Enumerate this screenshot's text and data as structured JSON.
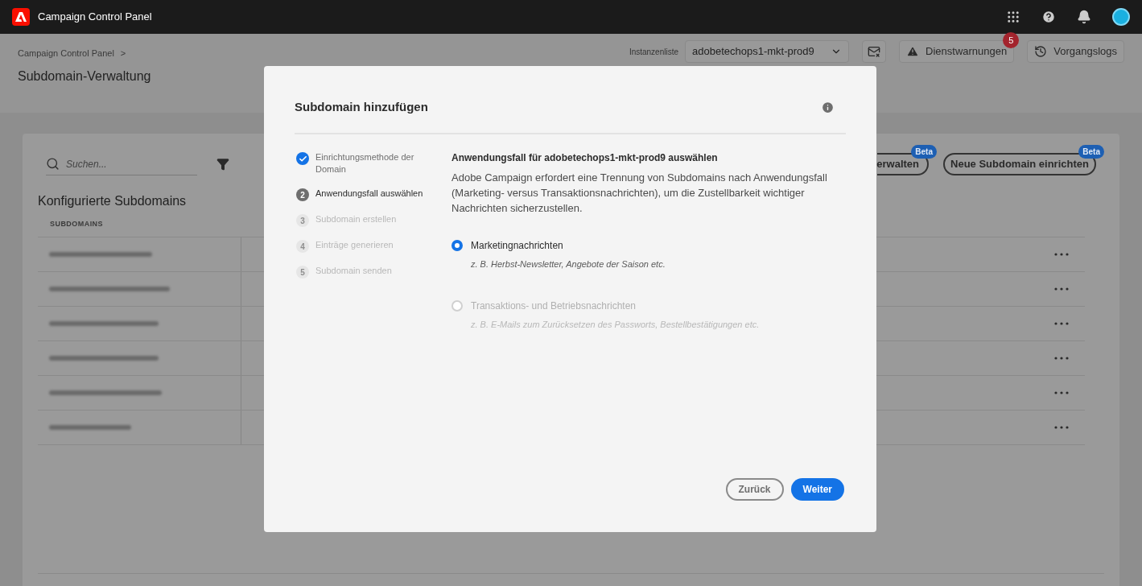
{
  "top_bar": {
    "title": "Campaign Control Panel"
  },
  "header": {
    "breadcrumb": "Campaign Control Panel",
    "breadcrumb_separator": ">",
    "title": "Subdomain-Verwaltung",
    "instance_label": "Instanzenliste",
    "instance_value": "adobetechops1-mkt-prod9",
    "buttons": [
      {
        "kind": "mail"
      },
      {
        "kind": "warning",
        "label": "Dienstwarnungen",
        "badge": "5"
      },
      {
        "kind": "history",
        "label": "Vorgangslogs"
      }
    ]
  },
  "card": {
    "search": {
      "placeholder": "Suchen..."
    },
    "actions": [
      {
        "label": "erwalten",
        "badge": "Beta"
      },
      {
        "label": "Neue Subdomain einrichten",
        "badge": "Beta"
      }
    ],
    "title": "Konfigurierte Subdomains",
    "column": "SUBDOMAINS",
    "rows": [
      {
        "kind": "blurred"
      },
      {
        "kind": "blurred"
      },
      {
        "kind": "blurred"
      },
      {
        "kind": "blurred"
      },
      {
        "kind": "blurred"
      },
      {
        "kind": "blurred"
      }
    ]
  },
  "dialog": {
    "title": "Subdomain hinzufügen",
    "steps": [
      {
        "label": "Einrichtungsmethode der Domain",
        "completed": true,
        "selected": false
      },
      {
        "number": "2",
        "label": "Anwendungsfall auswählen",
        "completed": false,
        "selected": true
      },
      {
        "number": "3",
        "label": "Subdomain erstellen",
        "completed": false,
        "selected": false
      },
      {
        "number": "4",
        "label": "Einträge generieren",
        "completed": false,
        "selected": false
      },
      {
        "number": "5",
        "label": "Subdomain senden",
        "completed": false,
        "selected": false
      }
    ],
    "heading": "Anwendungsfall für adobetechops1-mkt-prod9 auswählen",
    "description": "Adobe Campaign erfordert eine Trennung von Subdomains nach Anwendungsfall (Marketing- versus Transaktionsnachrichten), um die Zustellbarkeit wichtiger Nachrichten sicherzustellen.",
    "options": [
      {
        "label": "Marketingnachrichten",
        "hint": "z. B. Herbst-Newsletter, Angebote der Saison etc.",
        "selected": true,
        "disabled": false
      },
      {
        "label": "Transaktions- und Betriebsnachrichten",
        "hint": "z. B. E-Mails zum Zurücksetzen des Passworts, Bestellbestätigungen etc.",
        "selected": false,
        "disabled": true
      }
    ],
    "back": "Zurück",
    "next": "Weiter"
  }
}
